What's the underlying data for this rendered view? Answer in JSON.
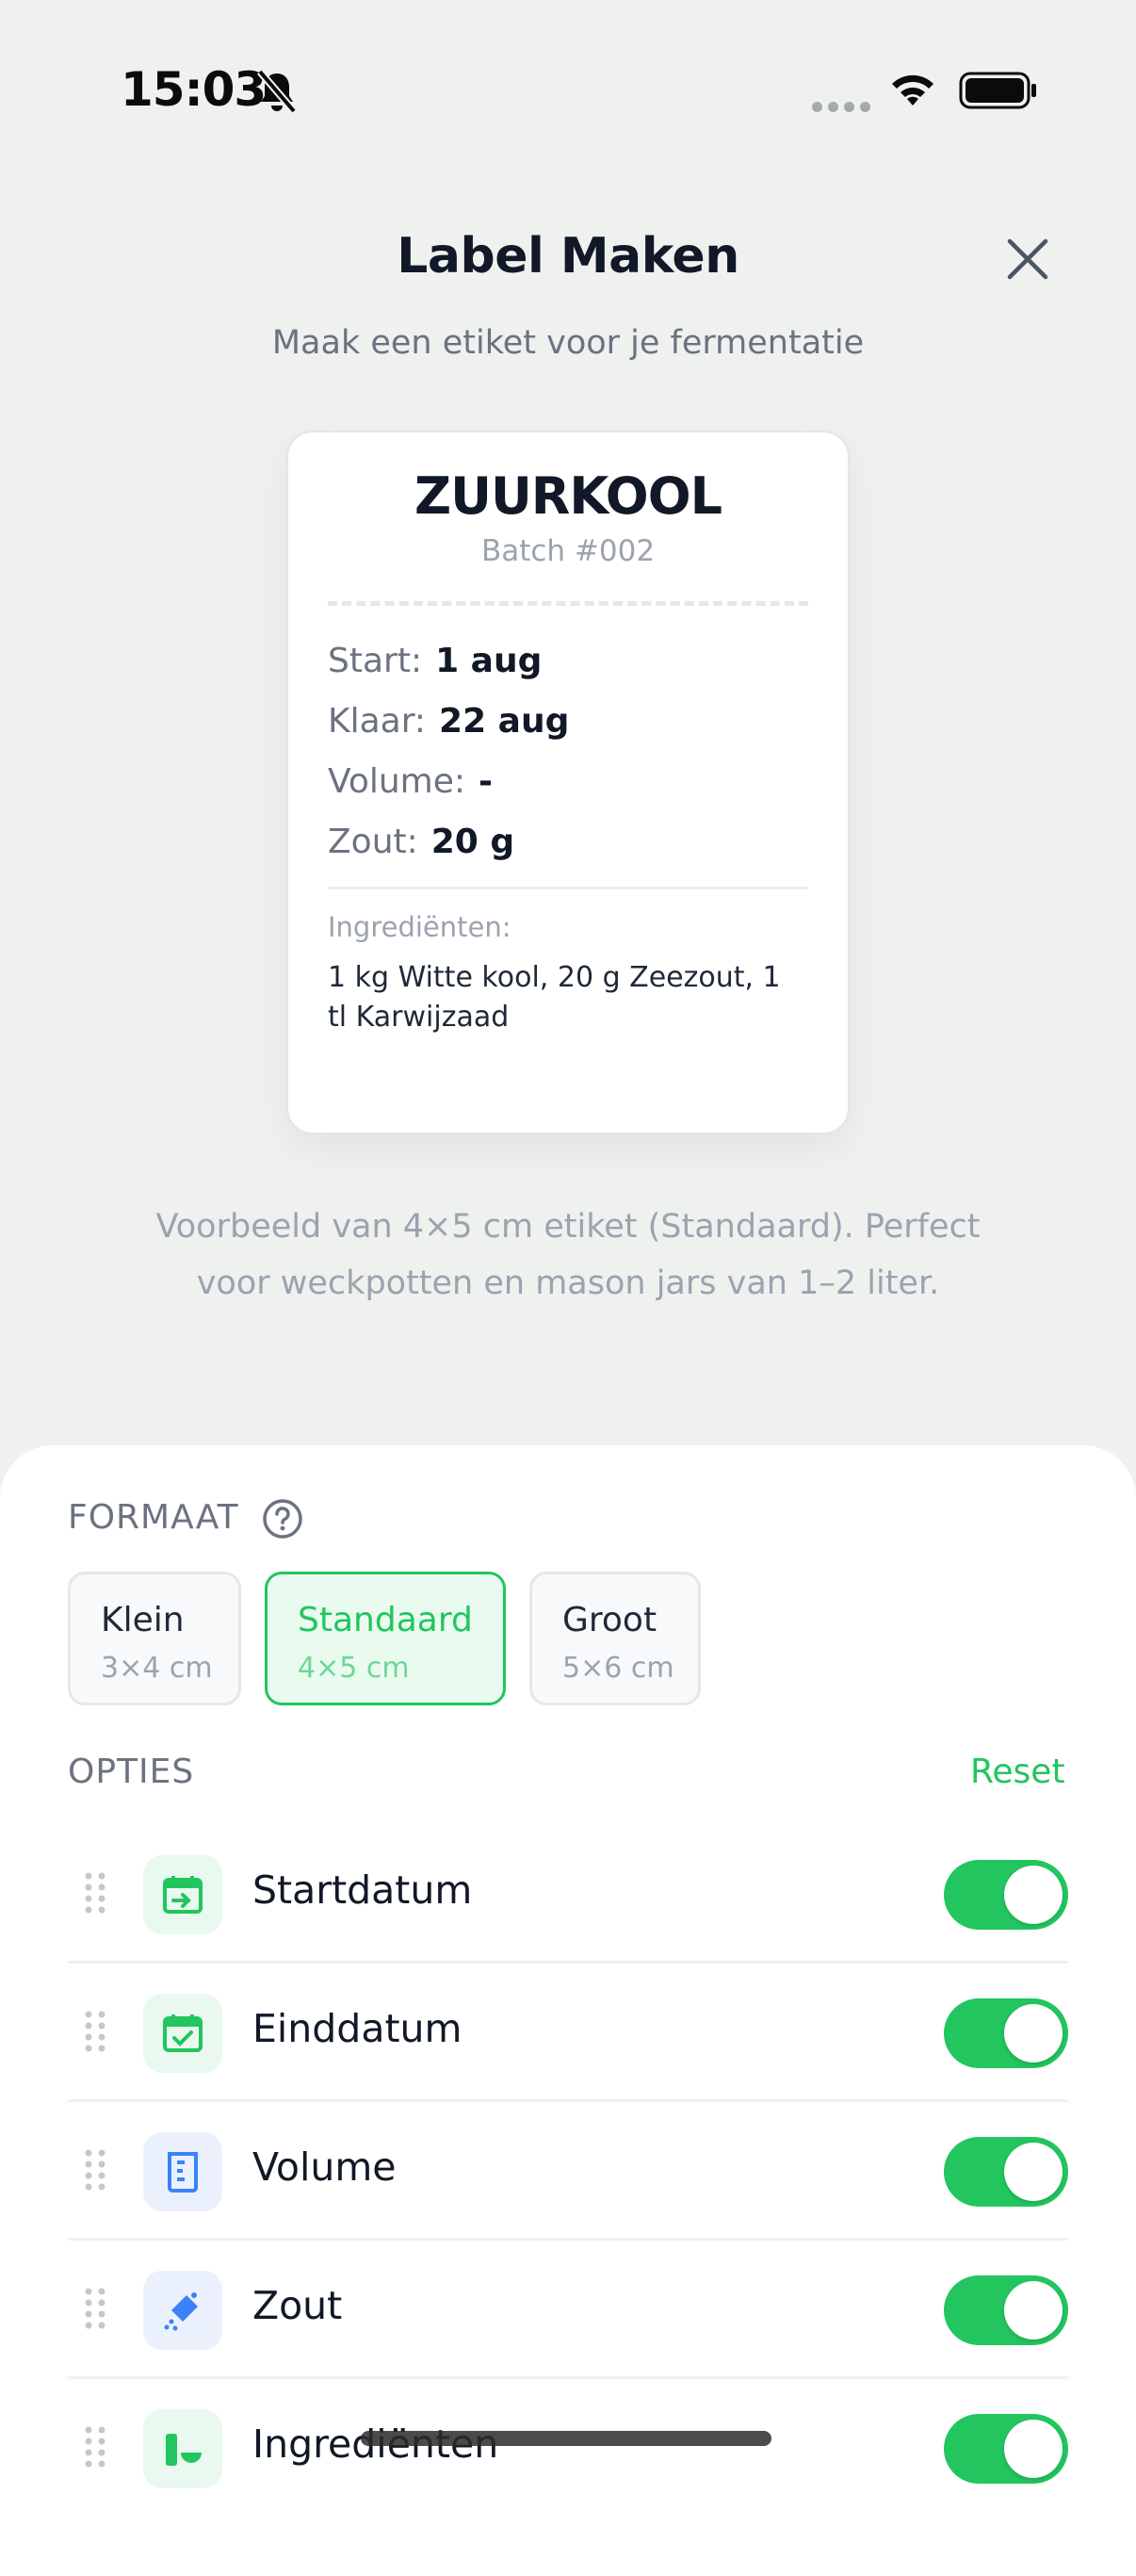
{
  "status": {
    "time": "15:03"
  },
  "header": {
    "title": "Label Maken",
    "subtitle": "Maak een etiket voor je fermentatie"
  },
  "label": {
    "name": "ZUURKOOL",
    "batch": "Batch #002",
    "rows": [
      {
        "key": "Start:",
        "value": "1 aug"
      },
      {
        "key": "Klaar:",
        "value": "22 aug"
      },
      {
        "key": "Volume:",
        "value": "-"
      },
      {
        "key": "Zout:",
        "value": "20 g"
      }
    ],
    "ingredients_label": "Ingrediënten:",
    "ingredients": "1 kg Witte kool, 20 g Zeezout, 1 tl Karwijzaad"
  },
  "caption": "Voorbeeld van 4×5 cm etiket (Standaard). Perfect voor weckpotten en mason jars van 1–2 liter.",
  "format": {
    "label": "FORMAAT",
    "options": [
      {
        "name": "Klein",
        "size": "3×4 cm",
        "selected": false
      },
      {
        "name": "Standaard",
        "size": "4×5 cm",
        "selected": true
      },
      {
        "name": "Groot",
        "size": "5×6 cm",
        "selected": false
      }
    ]
  },
  "options": {
    "label": "OPTIES",
    "reset": "Reset",
    "items": [
      {
        "label": "Startdatum",
        "icon": "calendar-start-icon",
        "enabled": true
      },
      {
        "label": "Einddatum",
        "icon": "calendar-check-icon",
        "enabled": true
      },
      {
        "label": "Volume",
        "icon": "beaker-icon",
        "enabled": true
      },
      {
        "label": "Zout",
        "icon": "salt-shaker-icon",
        "enabled": true
      },
      {
        "label": "Ingrediënten",
        "icon": "ingredients-icon",
        "enabled": true
      }
    ]
  },
  "colors": {
    "accent": "#22c55e",
    "background": "#eff1ef"
  }
}
